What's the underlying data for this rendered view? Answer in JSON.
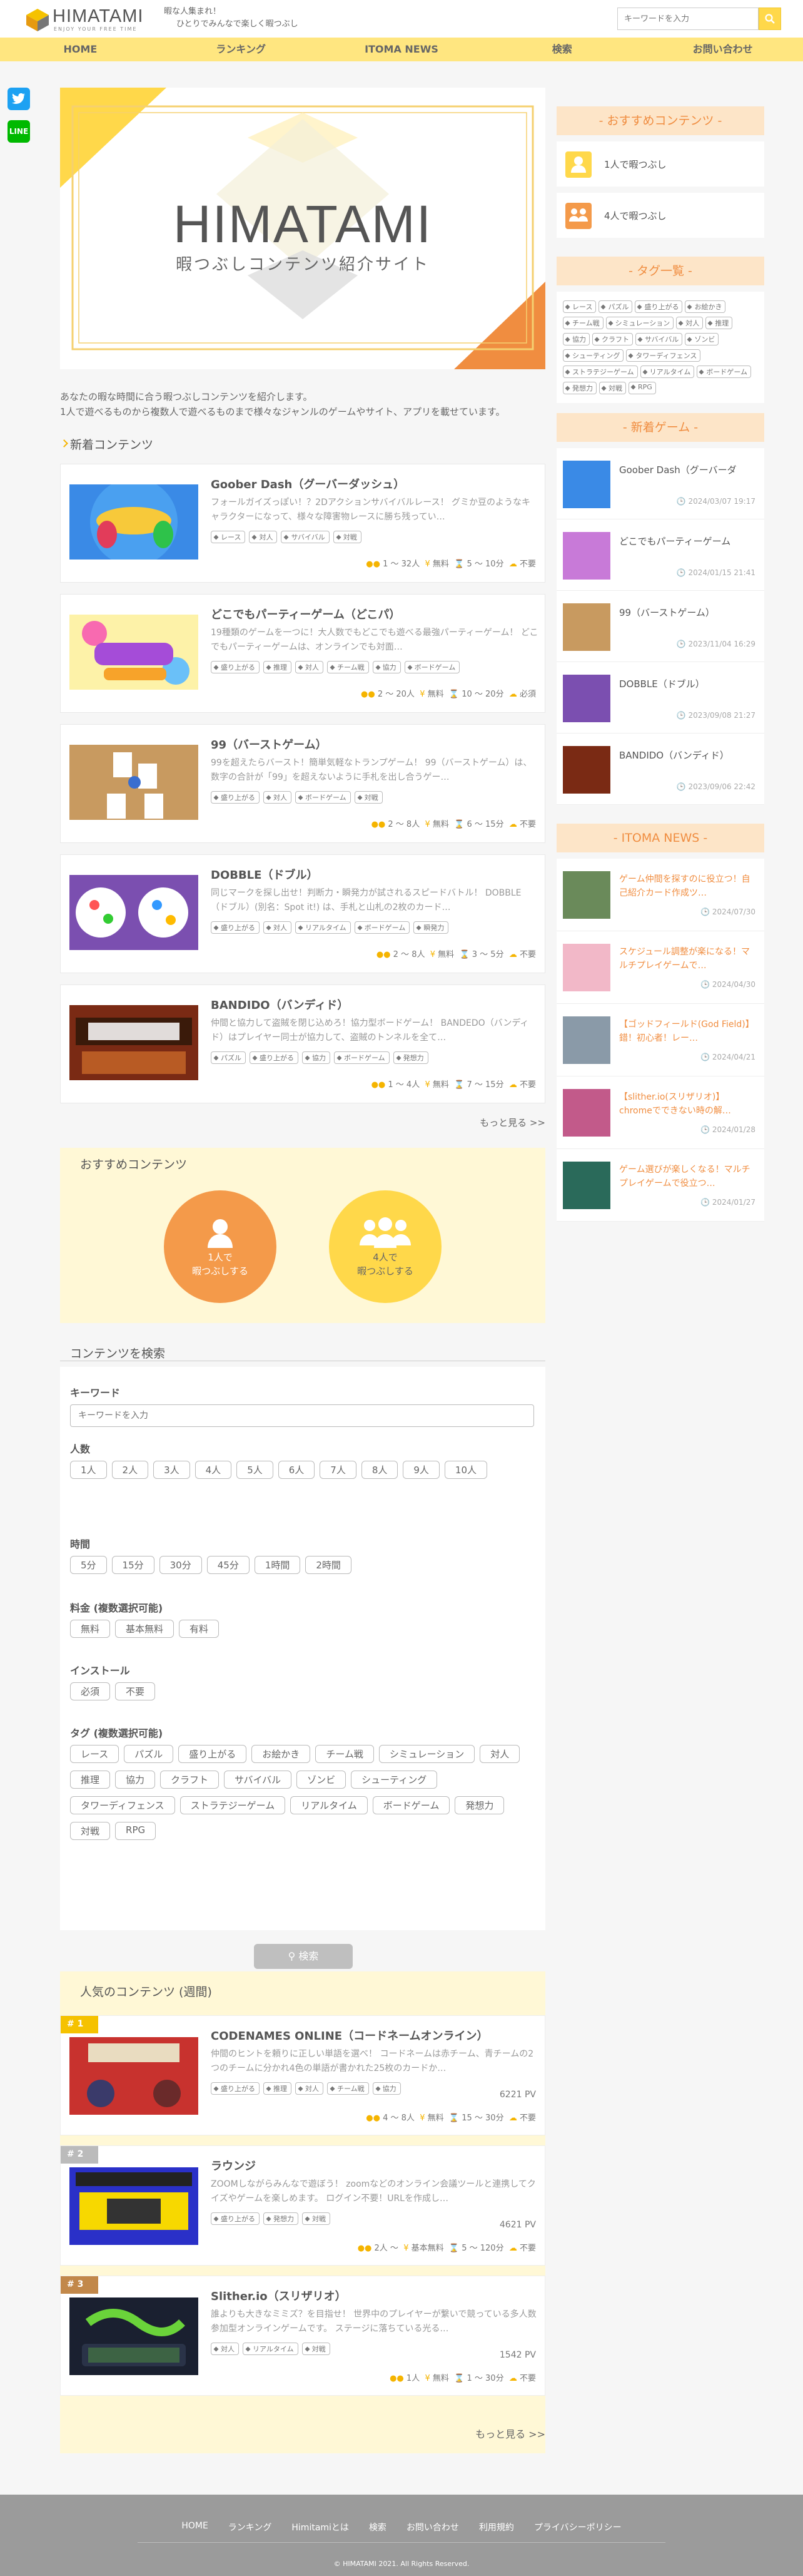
{
  "header": {
    "logo": "HIMATAMI",
    "tagline": "ENJOY YOUR FREE TIME",
    "catch": [
      "暇な人集まれ！",
      "ひとりでみんなで楽しく暇つぶし"
    ],
    "search_placeholder": "キーワードを入力"
  },
  "nav": [
    "HOME",
    "ランキング",
    "ITOMA NEWS",
    "検索",
    "お問い合わせ"
  ],
  "share": {
    "twitter": "twitter-icon",
    "line": "LINE"
  },
  "hero": {
    "title": "HIMATAMI",
    "subtitle": "暇つぶしコンテンツ紹介サイト"
  },
  "intro": [
    "あなたの暇な時間に合う暇つぶしコンテンツを紹介します。",
    "1人で遊べるものから複数人で遊べるものまで様々なジャンルのゲームやサイト、アプリを載せています。"
  ],
  "new_section": {
    "title": "新着コンテンツ",
    "more": "もっと見る >>",
    "items": [
      {
        "title": "Goober Dash（グーバーダッシュ）",
        "desc": "フォールガイズっぽい！？2Dアクションサバイバルレース！ グミか豆のようなキャラクターになって、様々な障害物レースに勝ち残ってい…",
        "tags": [
          "レース",
          "対人",
          "サバイバル",
          "対戦"
        ],
        "players": "1 ～ 32人",
        "price": "無料",
        "time": "5 ～ 10分",
        "install": "不要"
      },
      {
        "title": "どこでもパーティーゲーム（どこパ）",
        "desc": "19種類のゲームを一つに！大人数でもどこでも遊べる最強パーティーゲーム！ どこでもパーティーゲームは、オンラインでも対面…",
        "tags": [
          "盛り上がる",
          "推理",
          "対人",
          "チーム戦",
          "協力",
          "ボードゲーム"
        ],
        "players": "2 ～ 20人",
        "price": "無料",
        "time": "10 ～ 20分",
        "install": "必須"
      },
      {
        "title": "99（バーストゲーム）",
        "desc": "99を超えたらバースト！簡単気軽なトランプゲーム！ 99（バーストゲーム）は、数字の合計が「99」を超えないように手札を出し合うゲー…",
        "tags": [
          "盛り上がる",
          "対人",
          "ボードゲーム",
          "対戦"
        ],
        "players": "2 ～ 8人",
        "price": "無料",
        "time": "6 ～ 15分",
        "install": "不要"
      },
      {
        "title": "DOBBLE（ドブル）",
        "desc": "同じマークを探し出せ！判断力・瞬発力が試されるスピードバトル！ DOBBLE（ドブル）(別名：Spot it!) は、手札と山札の2枚のカード…",
        "tags": [
          "盛り上がる",
          "対人",
          "リアルタイム",
          "ボードゲーム",
          "瞬発力"
        ],
        "players": "2 ～ 8人",
        "price": "無料",
        "time": "3 ～ 5分",
        "install": "不要"
      },
      {
        "title": "BANDIDO（バンディド）",
        "desc": "仲間と協力して盗賊を閉じ込めろ！協力型ボードゲーム！ BANDEDO（バンディド）はプレイヤー同士が協力して、盗賊のトンネルを全て…",
        "tags": [
          "パズル",
          "盛り上がる",
          "協力",
          "ボードゲーム",
          "発想力"
        ],
        "players": "1 ～ 4人",
        "price": "無料",
        "time": "7 ～ 15分",
        "install": "不要"
      }
    ]
  },
  "recommend": {
    "title": "おすすめコンテンツ",
    "items": [
      "1人で\n暇つぶしする",
      "4人で\n暇つぶしする"
    ]
  },
  "search": {
    "title": "コンテンツを検索",
    "keyword_label": "キーワード",
    "keyword_placeholder": "キーワードを入力",
    "players_label": "人数",
    "players": [
      "1人",
      "2人",
      "3人",
      "4人",
      "5人",
      "6人",
      "7人",
      "8人",
      "9人",
      "10人"
    ],
    "time_label": "時間",
    "times": [
      "5分",
      "15分",
      "30分",
      "45分",
      "1時間",
      "2時間"
    ],
    "price_label": "料金 (複数選択可能)",
    "prices": [
      "無料",
      "基本無料",
      "有料"
    ],
    "install_label": "インストール",
    "installs": [
      "必須",
      "不要"
    ],
    "tag_label": "タグ (複数選択可能)",
    "tags": [
      "レース",
      "パズル",
      "盛り上がる",
      "お絵かき",
      "チーム戦",
      "シミュレーション",
      "対人",
      "推理",
      "協力",
      "クラフト",
      "サバイバル",
      "ゾンビ",
      "シューティング",
      "タワーディフェンス",
      "ストラテジーゲーム",
      "リアルタイム",
      "ボードゲーム",
      "発想力",
      "対戦",
      "RPG"
    ],
    "button": "検索"
  },
  "popular": {
    "title": "人気のコンテンツ (週間)",
    "more": "もっと見る >>",
    "items": [
      {
        "rank": "1",
        "title": "CODENAMES ONLINE（コードネームオンライン）",
        "desc": "仲間のヒントを頼りに正しい単語を選べ！ コードネームは赤チーム、青チームの2つのチームに分かれ4色の単語が書かれた25枚のカードか…",
        "tags": [
          "盛り上がる",
          "推理",
          "対人",
          "チーム戦",
          "協力"
        ],
        "views": "6221 PV",
        "players": "4 ～ 8人",
        "price": "無料",
        "time": "15 ～ 30分",
        "install": "不要"
      },
      {
        "rank": "2",
        "title": "ラウンジ",
        "desc": "ZOOMしながらみんなで遊ぼう！ zoomなどのオンライン会議ツールと連携してクイズやゲームを楽しめます。 ログイン不要！URLを作成し…",
        "tags": [
          "盛り上がる",
          "発想力",
          "対戦"
        ],
        "views": "4621 PV",
        "players": "2人 ～",
        "price": "基本無料",
        "time": "5 ～ 120分",
        "install": "不要"
      },
      {
        "rank": "3",
        "title": "Slither.io（スリザリオ）",
        "desc": "誰よりも大きなミミズ？を目指せ！ 世界中のプレイヤーが繋いで競っている多人数参加型オンラインゲームです。 ステージに落ちている光る…",
        "tags": [
          "対人",
          "リアルタイム",
          "対戦"
        ],
        "views": "1542 PV",
        "players": "1人",
        "price": "無料",
        "time": "1 ～ 30分",
        "install": "不要"
      }
    ]
  },
  "sidebar": {
    "recommend_title": "- おすすめコンテンツ -",
    "recommend": [
      "1人で暇つぶし",
      "4人で暇つぶし"
    ],
    "tags_title": "- タグ一覧 -",
    "tags": [
      "レース",
      "パズル",
      "盛り上がる",
      "お絵かき",
      "チーム戦",
      "シミュレーション",
      "対人",
      "推理",
      "協力",
      "クラフト",
      "サバイバル",
      "ゾンビ",
      "シューティング",
      "タワーディフェンス",
      "ストラテジーゲーム",
      "リアルタイム",
      "ボードゲーム",
      "発想力",
      "対戦",
      "RPG"
    ],
    "games_title": "- 新着ゲーム -",
    "games": [
      {
        "title": "Goober Dash（グーバーダ",
        "date": "2024/03/07 19:17"
      },
      {
        "title": "どこでもパーティーゲーム",
        "date": "2024/01/15 21:41"
      },
      {
        "title": "99（バーストゲーム）",
        "date": "2023/11/04 16:29"
      },
      {
        "title": "DOBBLE（ドブル）",
        "date": "2023/09/08 21:27"
      },
      {
        "title": "BANDIDO（バンディド）",
        "date": "2023/09/06 22:42"
      }
    ],
    "news_title": "- ITOMA NEWS -",
    "news": [
      {
        "title": "ゲーム仲間を探すのに役立つ！自己紹介カード作成ツ…",
        "date": "2024/07/30"
      },
      {
        "title": "スケジュール調整が楽になる！マルチプレイゲームで…",
        "date": "2024/04/30"
      },
      {
        "title": "【ゴッドフィールド(God Field)】 錯！初心者！レー…",
        "date": "2024/04/21"
      },
      {
        "title": "【slither.io(スリザリオ)】chromeでできない時の解…",
        "date": "2024/01/28"
      },
      {
        "title": "ゲーム選びが楽しくなる！マルチプレイゲームで役立つ…",
        "date": "2024/01/27"
      }
    ]
  },
  "footer": {
    "links": [
      "HOME",
      "ランキング",
      "Himitamiとは",
      "検索",
      "お問い合わせ",
      "利用規約",
      "プライバシーポリシー"
    ],
    "copyright": "© HIMATAMI 2021. All Rights Reserved."
  },
  "colors": {
    "accent": "#ffd84a",
    "orange": "#f08d40",
    "nav": "#ffe680"
  }
}
